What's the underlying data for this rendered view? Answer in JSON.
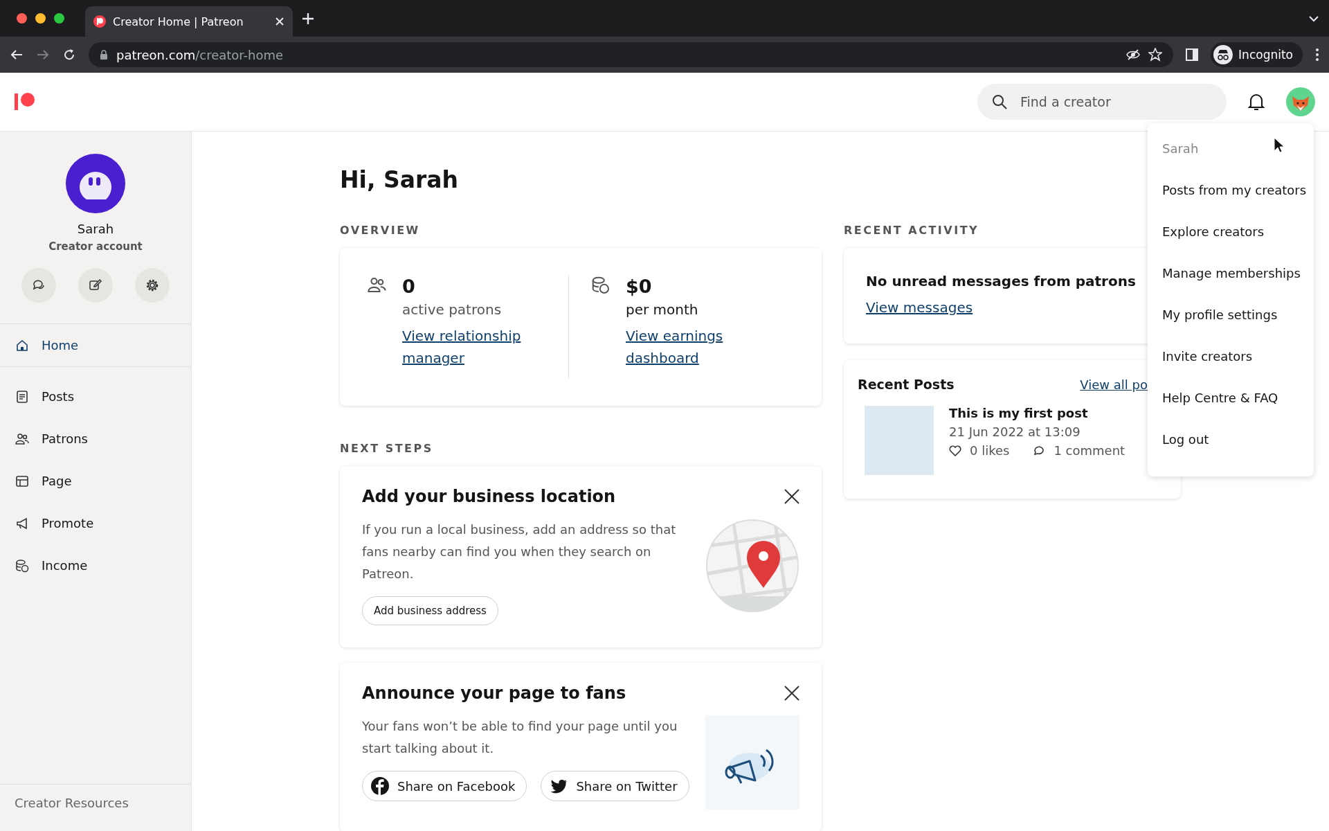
{
  "browser": {
    "tab_title": "Creator Home | Patreon",
    "url_host": "patreon.com",
    "url_path": "/creator-home",
    "profile_label": "Incognito"
  },
  "header": {
    "search": {
      "placeholder": "Find a creator"
    }
  },
  "sidebar": {
    "user_name": "Sarah",
    "account_type": "Creator account",
    "nav": [
      {
        "label": "Home",
        "selected": true
      },
      {
        "label": "Posts",
        "selected": false
      },
      {
        "label": "Patrons",
        "selected": false
      },
      {
        "label": "Page",
        "selected": false
      },
      {
        "label": "Promote",
        "selected": false
      },
      {
        "label": "Income",
        "selected": false
      }
    ],
    "footer": "Creator Resources"
  },
  "greeting": "Hi, Sarah",
  "overview": {
    "heading": "OVERVIEW",
    "stats": [
      {
        "value": "0",
        "label": "active patrons",
        "link": "View relationship manager"
      },
      {
        "value": "$0",
        "label": "per month",
        "link": "View earnings dashboard"
      }
    ]
  },
  "next_steps": {
    "heading": "NEXT STEPS",
    "cards": [
      {
        "title": "Add your business location",
        "body": "If you run a local business, add an address so that fans nearby can find you when they search on Patreon.",
        "buttons": [
          {
            "label": "Add business address",
            "kind": "plain"
          }
        ]
      },
      {
        "title": "Announce your page to fans",
        "body": "Your fans won’t be able to find your page until you start talking about it.",
        "buttons": [
          {
            "label": "Share on Facebook",
            "kind": "facebook"
          },
          {
            "label": "Share on Twitter",
            "kind": "twitter"
          }
        ]
      }
    ]
  },
  "recent_activity": {
    "heading": "RECENT ACTIVITY",
    "messages": {
      "title": "No unread messages from patrons",
      "link": "View messages"
    },
    "recent_posts": {
      "title": "Recent Posts",
      "link": "View all po",
      "posts": [
        {
          "title": "This is my first post",
          "date": "21 Jun 2022 at 13:09",
          "likes": "0 likes",
          "comments": "1 comment"
        }
      ]
    }
  },
  "account_menu": {
    "user": "Sarah",
    "items": [
      "Posts from my creators",
      "Explore creators",
      "Manage memberships",
      "My profile settings",
      "Invite creators",
      "Help Centre & FAQ",
      "Log out"
    ]
  }
}
